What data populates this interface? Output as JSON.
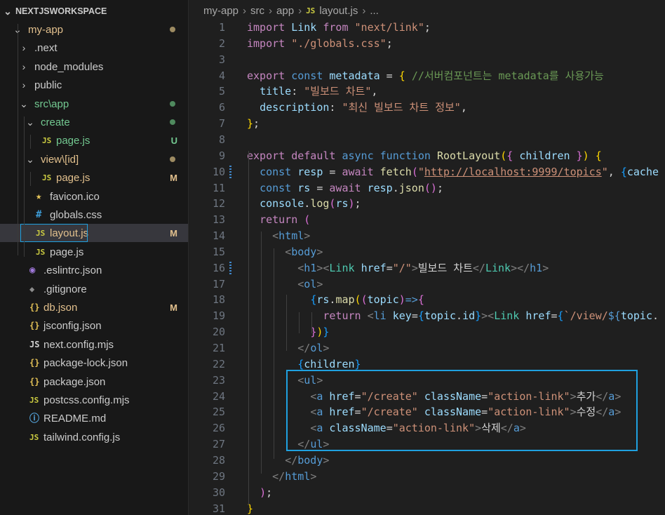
{
  "explorer": {
    "workspace": "NEXTJSWORKSPACE",
    "items": [
      {
        "label": "my-app",
        "type": "folder-open",
        "depth": 0,
        "color": "gold",
        "status_dot": "gold"
      },
      {
        "label": ".next",
        "type": "folder",
        "depth": 1
      },
      {
        "label": "node_modules",
        "type": "folder",
        "depth": 1
      },
      {
        "label": "public",
        "type": "folder",
        "depth": 1
      },
      {
        "label": "src\\app",
        "type": "folder-open",
        "depth": 1,
        "color": "green",
        "status_dot": "green"
      },
      {
        "label": "create",
        "type": "folder-open",
        "depth": 2,
        "color": "green",
        "status_dot": "green"
      },
      {
        "label": "page.js",
        "type": "js",
        "depth": 3,
        "color": "green",
        "status": "U"
      },
      {
        "label": "view\\[id]",
        "type": "folder-open",
        "depth": 2,
        "color": "gold",
        "status_dot": "gold"
      },
      {
        "label": "page.js",
        "type": "js",
        "depth": 3,
        "color": "gold",
        "status": "M"
      },
      {
        "label": "favicon.ico",
        "type": "star",
        "depth": 2
      },
      {
        "label": "globals.css",
        "type": "hash",
        "depth": 2
      },
      {
        "label": "layout.js",
        "type": "js",
        "depth": 2,
        "color": "gold",
        "status": "M",
        "selected": true
      },
      {
        "label": "page.js",
        "type": "js",
        "depth": 2
      },
      {
        "label": ".eslintrc.json",
        "type": "eslint",
        "depth": 1
      },
      {
        "label": ".gitignore",
        "type": "git",
        "depth": 1
      },
      {
        "label": "db.json",
        "type": "brace",
        "depth": 1,
        "color": "gold",
        "status": "M"
      },
      {
        "label": "jsconfig.json",
        "type": "brace",
        "depth": 1
      },
      {
        "label": "next.config.mjs",
        "type": "next",
        "depth": 1
      },
      {
        "label": "package-lock.json",
        "type": "brace",
        "depth": 1
      },
      {
        "label": "package.json",
        "type": "brace",
        "depth": 1
      },
      {
        "label": "postcss.config.mjs",
        "type": "js",
        "depth": 1
      },
      {
        "label": "README.md",
        "type": "info",
        "depth": 1
      },
      {
        "label": "tailwind.config.js",
        "type": "js",
        "depth": 1
      }
    ]
  },
  "icons": {
    "js": "JS",
    "star": "★",
    "hash": "#",
    "brace": "{}",
    "eslint": "◉",
    "git": "◆",
    "info": "ⓘ",
    "next": "JS"
  },
  "breadcrumb": [
    "my-app",
    "src",
    "app",
    "layout.js",
    "..."
  ],
  "code_lines": [
    [
      [
        "k",
        "import"
      ],
      [
        "w",
        " "
      ],
      [
        "v",
        "Link"
      ],
      [
        "w",
        " "
      ],
      [
        "k",
        "from"
      ],
      [
        "w",
        " "
      ],
      [
        "s",
        "\"next/link\""
      ],
      [
        "w",
        ";"
      ]
    ],
    [
      [
        "k",
        "import"
      ],
      [
        "w",
        " "
      ],
      [
        "s",
        "\"./globals.css\""
      ],
      [
        "w",
        ";"
      ]
    ],
    [],
    [
      [
        "k",
        "export"
      ],
      [
        "w",
        " "
      ],
      [
        "kb",
        "const"
      ],
      [
        "w",
        " "
      ],
      [
        "v",
        "metadata"
      ],
      [
        "w",
        " = "
      ],
      [
        "p1",
        "{"
      ],
      [
        "w",
        " "
      ],
      [
        "c",
        "//서버컴포넌트는 metadata를 사용가능"
      ]
    ],
    [
      [
        "w",
        "  "
      ],
      [
        "v",
        "title"
      ],
      [
        "w",
        ": "
      ],
      [
        "s",
        "\"빌보드 차트\""
      ],
      [
        "w",
        ","
      ]
    ],
    [
      [
        "w",
        "  "
      ],
      [
        "v",
        "description"
      ],
      [
        "w",
        ": "
      ],
      [
        "s",
        "\"최신 빌보드 차트 정보\""
      ],
      [
        "w",
        ","
      ]
    ],
    [
      [
        "p1",
        "}"
      ],
      [
        "w",
        ";"
      ]
    ],
    [],
    [
      [
        "k",
        "export"
      ],
      [
        "w",
        " "
      ],
      [
        "k",
        "default"
      ],
      [
        "w",
        " "
      ],
      [
        "kb",
        "async"
      ],
      [
        "w",
        " "
      ],
      [
        "kb",
        "function"
      ],
      [
        "w",
        " "
      ],
      [
        "f",
        "RootLayout"
      ],
      [
        "p1",
        "("
      ],
      [
        "p2",
        "{"
      ],
      [
        "w",
        " "
      ],
      [
        "v",
        "children"
      ],
      [
        "w",
        " "
      ],
      [
        "p2",
        "}"
      ],
      [
        "p1",
        ")"
      ],
      [
        "w",
        " "
      ],
      [
        "p1",
        "{"
      ]
    ],
    [
      [
        "w",
        "  "
      ],
      [
        "kb",
        "const"
      ],
      [
        "w",
        " "
      ],
      [
        "v",
        "resp"
      ],
      [
        "w",
        " = "
      ],
      [
        "k",
        "await"
      ],
      [
        "w",
        " "
      ],
      [
        "f",
        "fetch"
      ],
      [
        "p2",
        "("
      ],
      [
        "s",
        "\""
      ],
      [
        "u",
        "http://localhost:9999/topics"
      ],
      [
        "s",
        "\""
      ],
      [
        "w",
        ", "
      ],
      [
        "p3",
        "{"
      ],
      [
        "v",
        "cache"
      ]
    ],
    [
      [
        "w",
        "  "
      ],
      [
        "kb",
        "const"
      ],
      [
        "w",
        " "
      ],
      [
        "v",
        "rs"
      ],
      [
        "w",
        " = "
      ],
      [
        "k",
        "await"
      ],
      [
        "w",
        " "
      ],
      [
        "v",
        "resp"
      ],
      [
        "w",
        "."
      ],
      [
        "f",
        "json"
      ],
      [
        "p2",
        "()"
      ],
      [
        "w",
        ";"
      ]
    ],
    [
      [
        "w",
        "  "
      ],
      [
        "v",
        "console"
      ],
      [
        "w",
        "."
      ],
      [
        "f",
        "log"
      ],
      [
        "p2",
        "("
      ],
      [
        "v",
        "rs"
      ],
      [
        "p2",
        ")"
      ],
      [
        "w",
        ";"
      ]
    ],
    [
      [
        "w",
        "  "
      ],
      [
        "k",
        "return"
      ],
      [
        "w",
        " "
      ],
      [
        "p2",
        "("
      ]
    ],
    [
      [
        "w",
        "    "
      ],
      [
        "tg",
        "<"
      ],
      [
        "t",
        "html"
      ],
      [
        "tg",
        ">"
      ]
    ],
    [
      [
        "w",
        "      "
      ],
      [
        "tg",
        "<"
      ],
      [
        "t",
        "body"
      ],
      [
        "tg",
        ">"
      ]
    ],
    [
      [
        "w",
        "        "
      ],
      [
        "tg",
        "<"
      ],
      [
        "t",
        "h1"
      ],
      [
        "tg",
        "><"
      ],
      [
        "cmp",
        "Link"
      ],
      [
        "w",
        " "
      ],
      [
        "a",
        "href"
      ],
      [
        "w",
        "="
      ],
      [
        "s",
        "\"/\""
      ],
      [
        "tg",
        ">"
      ],
      [
        "w",
        "빌보드 차트"
      ],
      [
        "tg",
        "</"
      ],
      [
        "cmp",
        "Link"
      ],
      [
        "tg",
        "></"
      ],
      [
        "t",
        "h1"
      ],
      [
        "tg",
        ">"
      ]
    ],
    [
      [
        "w",
        "        "
      ],
      [
        "tg",
        "<"
      ],
      [
        "t",
        "ol"
      ],
      [
        "tg",
        ">"
      ]
    ],
    [
      [
        "w",
        "          "
      ],
      [
        "p3",
        "{"
      ],
      [
        "v",
        "rs"
      ],
      [
        "w",
        "."
      ],
      [
        "f",
        "map"
      ],
      [
        "p1",
        "("
      ],
      [
        "p2",
        "("
      ],
      [
        "v",
        "topic"
      ],
      [
        "p2",
        ")"
      ],
      [
        "kb",
        "=>"
      ],
      [
        "p2",
        "{"
      ]
    ],
    [
      [
        "w",
        "            "
      ],
      [
        "k",
        "return"
      ],
      [
        "w",
        " "
      ],
      [
        "tg",
        "<"
      ],
      [
        "t",
        "li"
      ],
      [
        "w",
        " "
      ],
      [
        "a",
        "key"
      ],
      [
        "w",
        "="
      ],
      [
        "p3",
        "{"
      ],
      [
        "v",
        "topic"
      ],
      [
        "w",
        "."
      ],
      [
        "v",
        "id"
      ],
      [
        "p3",
        "}"
      ],
      [
        "tg",
        "><"
      ],
      [
        "cmp",
        "Link"
      ],
      [
        "w",
        " "
      ],
      [
        "a",
        "href"
      ],
      [
        "w",
        "="
      ],
      [
        "p3",
        "{"
      ],
      [
        "s",
        "`/view/"
      ],
      [
        "kb",
        "${"
      ],
      [
        "v",
        "topic"
      ],
      [
        "w",
        "."
      ]
    ],
    [
      [
        "w",
        "          "
      ],
      [
        "p2",
        "}"
      ],
      [
        "p1",
        ")"
      ],
      [
        "p3",
        "}"
      ]
    ],
    [
      [
        "w",
        "        "
      ],
      [
        "tg",
        "</"
      ],
      [
        "t",
        "ol"
      ],
      [
        "tg",
        ">"
      ]
    ],
    [
      [
        "w",
        "        "
      ],
      [
        "p3",
        "{"
      ],
      [
        "v",
        "children"
      ],
      [
        "p3",
        "}"
      ]
    ],
    [
      [
        "w",
        "        "
      ],
      [
        "tg",
        "<"
      ],
      [
        "t",
        "ul"
      ],
      [
        "tg",
        ">"
      ]
    ],
    [
      [
        "w",
        "          "
      ],
      [
        "tg",
        "<"
      ],
      [
        "t",
        "a"
      ],
      [
        "w",
        " "
      ],
      [
        "a",
        "href"
      ],
      [
        "w",
        "="
      ],
      [
        "s",
        "\"/create\""
      ],
      [
        "w",
        " "
      ],
      [
        "a",
        "className"
      ],
      [
        "w",
        "="
      ],
      [
        "s",
        "\"action-link\""
      ],
      [
        "tg",
        ">"
      ],
      [
        "w",
        "추가"
      ],
      [
        "tg",
        "</"
      ],
      [
        "t",
        "a"
      ],
      [
        "tg",
        ">"
      ]
    ],
    [
      [
        "w",
        "          "
      ],
      [
        "tg",
        "<"
      ],
      [
        "t",
        "a"
      ],
      [
        "w",
        " "
      ],
      [
        "a",
        "href"
      ],
      [
        "w",
        "="
      ],
      [
        "s",
        "\"/create\""
      ],
      [
        "w",
        " "
      ],
      [
        "a",
        "className"
      ],
      [
        "w",
        "="
      ],
      [
        "s",
        "\"action-link\""
      ],
      [
        "tg",
        ">"
      ],
      [
        "w",
        "수정"
      ],
      [
        "tg",
        "</"
      ],
      [
        "t",
        "a"
      ],
      [
        "tg",
        ">"
      ]
    ],
    [
      [
        "w",
        "          "
      ],
      [
        "tg",
        "<"
      ],
      [
        "t",
        "a"
      ],
      [
        "w",
        " "
      ],
      [
        "a",
        "className"
      ],
      [
        "w",
        "="
      ],
      [
        "s",
        "\"action-link\""
      ],
      [
        "tg",
        ">"
      ],
      [
        "w",
        "삭제"
      ],
      [
        "tg",
        "</"
      ],
      [
        "t",
        "a"
      ],
      [
        "tg",
        ">"
      ]
    ],
    [
      [
        "w",
        "        "
      ],
      [
        "tg",
        "</"
      ],
      [
        "t",
        "ul"
      ],
      [
        "tg",
        ">"
      ]
    ],
    [
      [
        "w",
        "      "
      ],
      [
        "tg",
        "</"
      ],
      [
        "t",
        "body"
      ],
      [
        "tg",
        ">"
      ]
    ],
    [
      [
        "w",
        "    "
      ],
      [
        "tg",
        "</"
      ],
      [
        "t",
        "html"
      ],
      [
        "tg",
        ">"
      ]
    ],
    [
      [
        "w",
        "  "
      ],
      [
        "p2",
        ")"
      ],
      [
        "w",
        ";"
      ]
    ],
    [
      [
        "p1",
        "}"
      ]
    ]
  ],
  "modified_lines": [
    10,
    16
  ]
}
